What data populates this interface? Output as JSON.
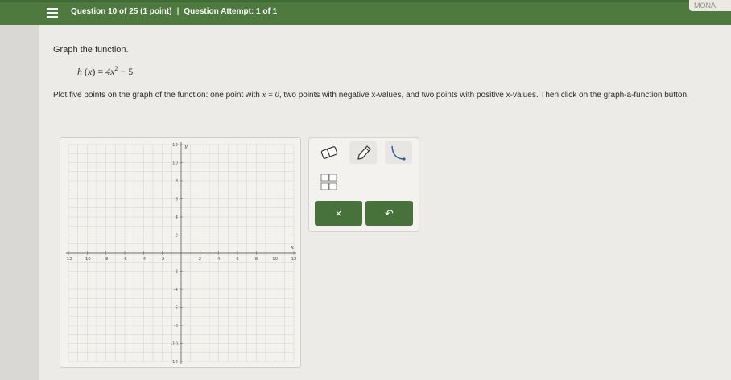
{
  "header": {
    "question": "Question 10 of 25 (1 point)",
    "separator": "|",
    "attempt": "Question Attempt: 1 of 1",
    "user": "MONA"
  },
  "problem": {
    "heading": "Graph the function.",
    "function_name": "h",
    "variable": "x",
    "equation_body": "4x",
    "exponent": "2",
    "equation_tail": "− 5",
    "instructions_1": "Plot five points on the graph of the function: one point with ",
    "instructions_eq": "x = 0",
    "instructions_2": ", two points with negative x-values, and two points with positive x-values. Then click on the graph-a-function button."
  },
  "graph": {
    "x_axis_label": "x",
    "y_axis_label": "y",
    "x_range": [
      -12,
      12
    ],
    "y_range": [
      -12,
      12
    ],
    "x_ticks": [
      "-12",
      "-10",
      "-8",
      "-6",
      "-4",
      "-2",
      "2",
      "4",
      "6",
      "8",
      "10",
      "12"
    ],
    "y_ticks": [
      "12",
      "10",
      "8",
      "6",
      "4",
      "2",
      "-2",
      "-4",
      "-6",
      "-8",
      "-10",
      "-12"
    ],
    "grid_color": "#d3d1cc",
    "axis_color": "#6a6a6a"
  },
  "tools": {
    "eraser": "eraser-icon",
    "pencil": "pencil-icon",
    "curve": "curve-icon",
    "fraction": "fraction-template-icon",
    "clear_label": "×",
    "undo_label": "↶",
    "button_color": "#47723c"
  }
}
